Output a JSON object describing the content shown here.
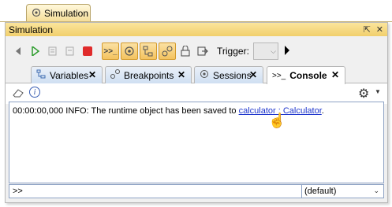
{
  "outer_tab": {
    "label": "Simulation",
    "icon": "simulation-icon"
  },
  "panel": {
    "title": "Simulation",
    "restore_symbol": "⇱",
    "close_symbol": "✕"
  },
  "toolbar": {
    "buttons": [
      "step-back-icon",
      "play-icon",
      "step-into-icon",
      "step-over-icon",
      "stop-icon",
      "console-icon",
      "session-icon",
      "variables-icon",
      "breakpoints-icon",
      "lock-icon",
      "export-icon"
    ],
    "trigger_label": "Trigger:",
    "trigger_value": ""
  },
  "tabs": [
    {
      "label": "Variables",
      "icon": "variables-icon",
      "close": "✕",
      "active": false
    },
    {
      "label": "Breakpoints",
      "icon": "breakpoints-icon",
      "close": "✕",
      "active": false
    },
    {
      "label": "Sessions",
      "icon": "sessions-icon",
      "close": "✕",
      "active": false
    },
    {
      "label": "Console",
      "icon": "console-icon",
      "close": "✕",
      "active": true
    }
  ],
  "tab_icons_text": {
    "variables": "⤷",
    "breakpoints": "⚬",
    "sessions": "☼",
    "console": ">>_"
  },
  "console": {
    "line_prefix": "00:00:00,000 INFO: The runtime object has been saved to ",
    "link_text": "calculator : Calculator",
    "line_suffix": "."
  },
  "input": {
    "value": ">>"
  },
  "scope_select": {
    "selected": "(default)"
  },
  "colors": {
    "accent": "#f4c35f",
    "link": "#1b33cc",
    "tab_blue": "#cfdff2"
  }
}
